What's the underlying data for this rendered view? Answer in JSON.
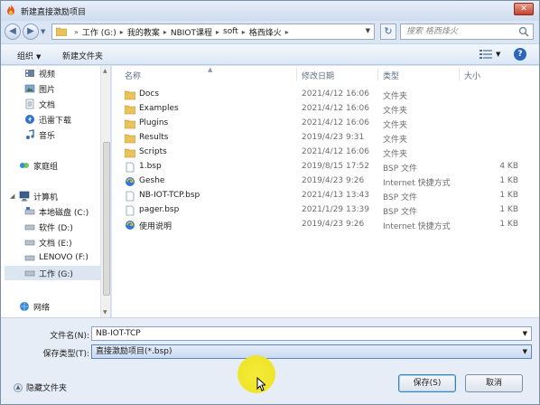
{
  "window": {
    "title": "新建直接激励项目",
    "close_label": "✕"
  },
  "address": {
    "crumbs": [
      "工作 (G:)",
      "我的教案",
      "NBIOT课程",
      "soft",
      "格西烽火"
    ],
    "search_placeholder": "搜索 格西烽火"
  },
  "toolbar": {
    "organize_label": "组织",
    "new_folder_label": "新建文件夹"
  },
  "navpane": {
    "favorites": [
      {
        "label": "视频",
        "icon": "video-library-icon"
      },
      {
        "label": "图片",
        "icon": "pictures-library-icon"
      },
      {
        "label": "文档",
        "icon": "documents-library-icon"
      },
      {
        "label": "迅雷下载",
        "icon": "thunder-download-icon"
      },
      {
        "label": "音乐",
        "icon": "music-library-icon"
      }
    ],
    "homegroup_label": "家庭组",
    "computer_label": "计算机",
    "drives": [
      {
        "label": "本地磁盘 (C:)",
        "selected": false
      },
      {
        "label": "软件 (D:)",
        "selected": false
      },
      {
        "label": "文档 (E:)",
        "selected": false
      },
      {
        "label": "LENOVO (F:)",
        "selected": false
      },
      {
        "label": "工作 (G:)",
        "selected": true
      }
    ],
    "network_label": "网络"
  },
  "filelist": {
    "columns": {
      "name": "名称",
      "date": "修改日期",
      "type": "类型",
      "size": "大小"
    },
    "rows": [
      {
        "name": "Docs",
        "date": "2021/4/12 16:06",
        "type": "文件夹",
        "size": "",
        "icon": "folder-icon"
      },
      {
        "name": "Examples",
        "date": "2021/4/12 16:06",
        "type": "文件夹",
        "size": "",
        "icon": "folder-icon"
      },
      {
        "name": "Plugins",
        "date": "2021/4/12 16:06",
        "type": "文件夹",
        "size": "",
        "icon": "folder-icon"
      },
      {
        "name": "Results",
        "date": "2019/4/23 9:31",
        "type": "文件夹",
        "size": "",
        "icon": "folder-icon"
      },
      {
        "name": "Scripts",
        "date": "2021/4/12 16:06",
        "type": "文件夹",
        "size": "",
        "icon": "folder-icon"
      },
      {
        "name": "1.bsp",
        "date": "2019/8/15 17:52",
        "type": "BSP 文件",
        "size": "4 KB",
        "icon": "file-icon"
      },
      {
        "name": "Geshe",
        "date": "2019/4/23 9:26",
        "type": "Internet 快捷方式",
        "size": "1 KB",
        "icon": "internet-shortcut-icon"
      },
      {
        "name": "NB-IOT-TCP.bsp",
        "date": "2021/4/13 13:43",
        "type": "BSP 文件",
        "size": "1 KB",
        "icon": "file-icon"
      },
      {
        "name": "pager.bsp",
        "date": "2021/1/29 13:39",
        "type": "BSP 文件",
        "size": "1 KB",
        "icon": "file-icon"
      },
      {
        "name": "使用说明",
        "date": "2019/4/23 9:26",
        "type": "Internet 快捷方式",
        "size": "1 KB",
        "icon": "internet-shortcut-icon"
      }
    ]
  },
  "save": {
    "filename_label": "文件名(N):",
    "filename_value": "NB-IOT-TCP",
    "filetype_label": "保存类型(T):",
    "filetype_value": "直接激励项目(*.bsp)",
    "hide_folders_label": "隐藏文件夹",
    "save_button": "保存(S)",
    "cancel_button": "取消"
  },
  "colors": {
    "folder": "#e8c25a",
    "accent": "#3c7fb1",
    "highlight": "#f0e52a"
  }
}
